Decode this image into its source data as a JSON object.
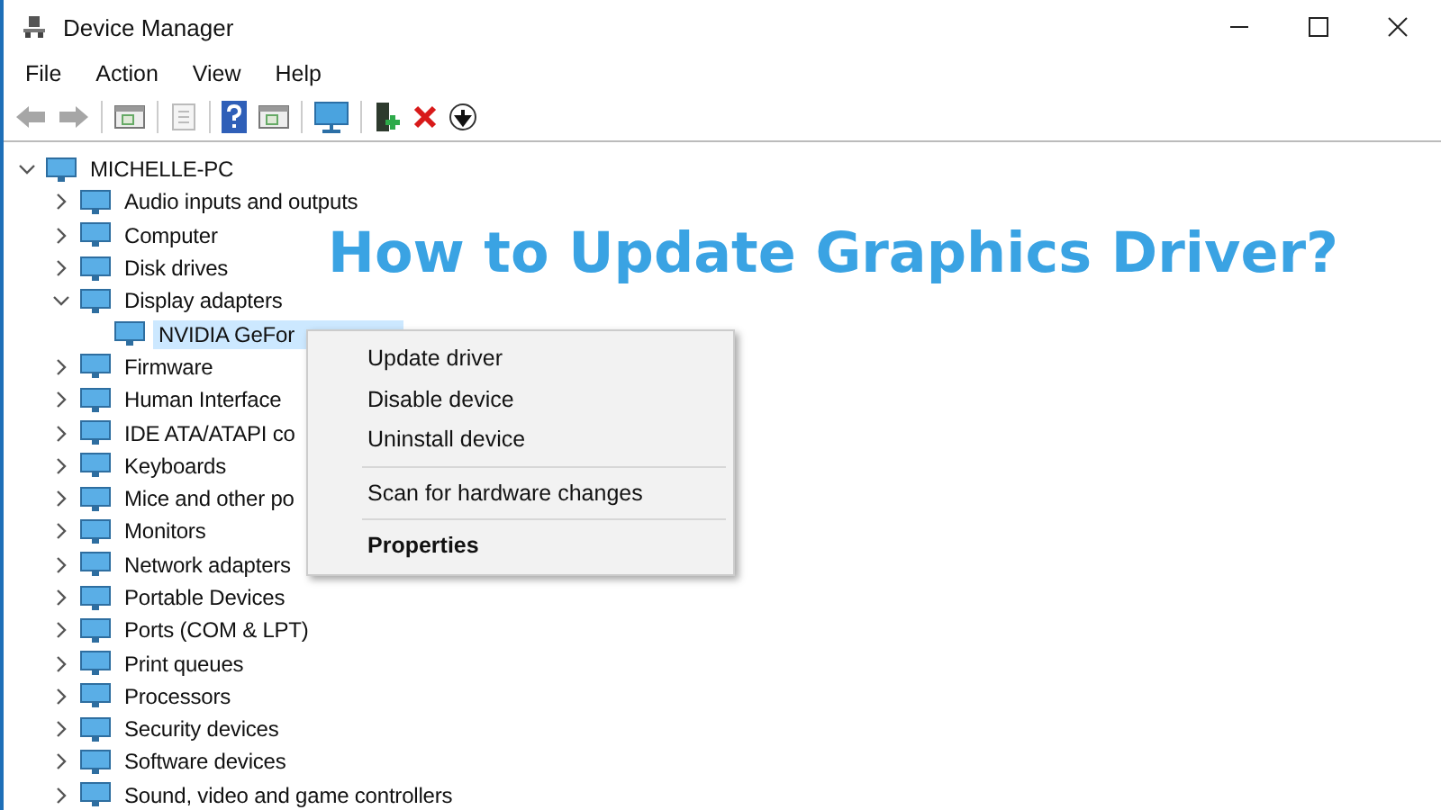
{
  "window": {
    "title": "Device Manager"
  },
  "menu_bar": [
    "File",
    "Action",
    "View",
    "Help"
  ],
  "toolbar": [
    {
      "kind": "back",
      "disabled": true
    },
    {
      "kind": "forward",
      "disabled": true
    },
    {
      "kind": "sep"
    },
    {
      "kind": "panel",
      "disabled": false
    },
    {
      "kind": "sep"
    },
    {
      "kind": "sheet",
      "disabled": true
    },
    {
      "kind": "sep"
    },
    {
      "kind": "help",
      "disabled": false
    },
    {
      "kind": "panel",
      "disabled": false
    },
    {
      "kind": "sep"
    },
    {
      "kind": "monitor",
      "disabled": false
    },
    {
      "kind": "sep"
    },
    {
      "kind": "add",
      "disabled": false
    },
    {
      "kind": "remove",
      "disabled": false
    },
    {
      "kind": "down",
      "disabled": false
    }
  ],
  "tree": [
    {
      "label": "MICHELLE-PC",
      "expanded": true,
      "selected": false,
      "children": [
        {
          "label": "Audio inputs and outputs",
          "expanded": false,
          "selected": false
        },
        {
          "label": "Computer",
          "expanded": false,
          "selected": false
        },
        {
          "label": "Disk drives",
          "expanded": false,
          "selected": false
        },
        {
          "label": "Display adapters",
          "expanded": true,
          "selected": false,
          "children": [
            {
              "label": "NVIDIA GeFor",
              "selected": true
            }
          ]
        },
        {
          "label": "Firmware",
          "expanded": false,
          "selected": false
        },
        {
          "label": "Human Interface",
          "expanded": false,
          "selected": false
        },
        {
          "label": "IDE ATA/ATAPI co",
          "expanded": false,
          "selected": false
        },
        {
          "label": "Keyboards",
          "expanded": false,
          "selected": false
        },
        {
          "label": "Mice and other po",
          "expanded": false,
          "selected": false
        },
        {
          "label": "Monitors",
          "expanded": false,
          "selected": false
        },
        {
          "label": "Network adapters",
          "expanded": false,
          "selected": false
        },
        {
          "label": "Portable Devices",
          "expanded": false,
          "selected": false
        },
        {
          "label": "Ports (COM & LPT)",
          "expanded": false,
          "selected": false
        },
        {
          "label": "Print queues",
          "expanded": false,
          "selected": false
        },
        {
          "label": "Processors",
          "expanded": false,
          "selected": false
        },
        {
          "label": "Security devices",
          "expanded": false,
          "selected": false
        },
        {
          "label": "Software devices",
          "expanded": false,
          "selected": false
        },
        {
          "label": "Sound, video and game controllers",
          "expanded": false,
          "selected": false
        }
      ]
    }
  ],
  "context_menu": [
    {
      "kind": "item",
      "label": "Update driver",
      "default": false
    },
    {
      "kind": "item",
      "label": "Disable device",
      "default": false
    },
    {
      "kind": "item",
      "label": "Uninstall device",
      "default": false
    },
    {
      "kind": "separator"
    },
    {
      "kind": "item",
      "label": "Scan for hardware changes",
      "default": false
    },
    {
      "kind": "separator"
    },
    {
      "kind": "item",
      "label": "Properties",
      "default": true
    }
  ],
  "overlay_title": "How to Update Graphics Driver?"
}
